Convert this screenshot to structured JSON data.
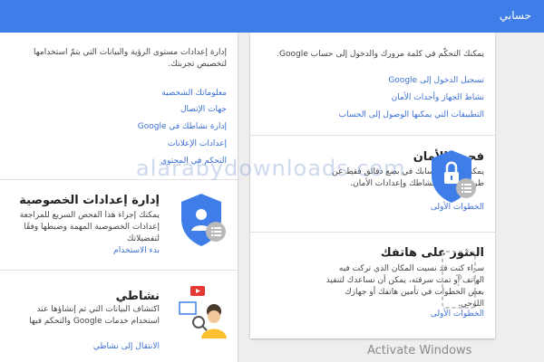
{
  "header": {
    "title": "حسابي"
  },
  "left_panel": {
    "intro": "إدارة إعدادات مستوى الرؤية والبيانات التي يتمّ استخدامها لتخصيص تجربتك.",
    "links": [
      "معلوماتك الشخصية",
      "جهات الإتصال",
      "إدارة نشاطك في Google",
      "إعدادات الإعلانات",
      "التحكم في المحتوى"
    ],
    "privacy": {
      "title": "إدارة إعدادات الخصوصية",
      "desc": "يمكنك إجراء هذا الفحص السريع للمراجعة إعدادات الخصوصية المهمة وضبطها وفقًا لتفضيلاتك",
      "action": "بدء الاستخدام"
    },
    "activity": {
      "title": "نشاطي",
      "desc": "اكتشاف البيانات التي تم إنشاؤها عند استخدام خدمات Google والتحكم فيها",
      "action": "الانتقال إلى نشاطي"
    }
  },
  "right_panel": {
    "intro": "يمكنك التحكّم في كلمة مرورك والدخول إلى حساب Google.",
    "links": [
      "تسجيل الدخول إلى Google",
      "نشاط الجهاز وأحداث الأمان",
      "التطبيقات التي يمكنها الوصول إلى الحساب"
    ],
    "security": {
      "title": "فحص الأمان",
      "desc": "يمكنك حماية حسابك في بضع دقائق فقط عن طريق مراجعة نشاطك وإعدادات الأمان.",
      "action": "الخطوات الأولى"
    },
    "find_phone": {
      "title": "العثور على هاتفك",
      "desc": "سواء كنت قد نسيت المكان الذي تركت فيه الهاتف أو تمت سرقته، يمكن أن نساعدك لتنفيذ بعض الخطوات في تأمين هاتفك أو جهازك اللوحي.",
      "action": "الخطوات الأولى"
    }
  },
  "watermark": "alarabydownloads.com",
  "os_notice": "Activate Windows",
  "colors": {
    "appbar": "#3f7ee8",
    "link": "#3b6fd6",
    "shield_blue": "#3f7ee8"
  }
}
